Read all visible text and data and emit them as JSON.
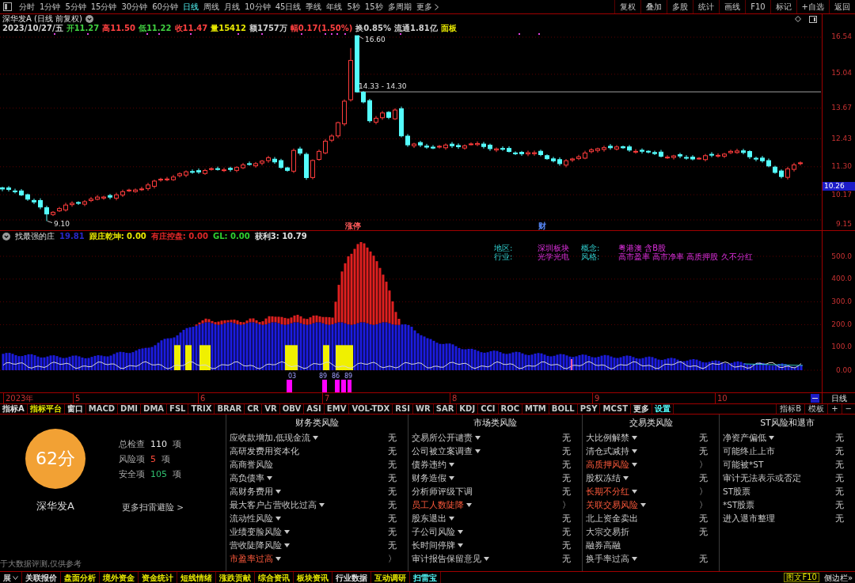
{
  "toolbar": {
    "periods": [
      {
        "label": "分时",
        "selected": false
      },
      {
        "label": "1分钟",
        "selected": false
      },
      {
        "label": "5分钟",
        "selected": false
      },
      {
        "label": "15分钟",
        "selected": false
      },
      {
        "label": "30分钟",
        "selected": false
      },
      {
        "label": "60分钟",
        "selected": false
      },
      {
        "label": "日线",
        "selected": true
      },
      {
        "label": "周线",
        "selected": false
      },
      {
        "label": "月线",
        "selected": false
      },
      {
        "label": "10分钟",
        "selected": false
      },
      {
        "label": "45日线",
        "selected": false
      },
      {
        "label": "季线",
        "selected": false
      },
      {
        "label": "年线",
        "selected": false
      },
      {
        "label": "5秒",
        "selected": false
      },
      {
        "label": "15秒",
        "selected": false
      },
      {
        "label": "多周期",
        "selected": false
      }
    ],
    "more": "更多",
    "actions": [
      "复权",
      "叠加",
      "多股",
      "统计",
      "画线",
      "F10",
      "标记",
      "+自选",
      "返回"
    ]
  },
  "chart_header": {
    "title": "深华发A (日线 前复权)",
    "quote": [
      {
        "text": "2023/10/27/五",
        "color": "#d0d0d0"
      },
      {
        "text": "开11.27",
        "color": "#40d040"
      },
      {
        "text": "高11.50",
        "color": "#ff4040"
      },
      {
        "text": "低11.22",
        "color": "#40d040"
      },
      {
        "text": "收11.47",
        "color": "#ff4040"
      },
      {
        "text": "量15412",
        "color": "#e8e800"
      },
      {
        "text": "额1757万",
        "color": "#d0d0d0"
      },
      {
        "text": "幅0.17(1.50%)",
        "color": "#ff4040"
      },
      {
        "text": "换0.85%",
        "color": "#d0d0d0"
      },
      {
        "text": "流通1.81亿",
        "color": "#d0d0d0"
      },
      {
        "text": "面板",
        "color": "#e8e800"
      }
    ]
  },
  "price_chart": {
    "axis": [
      "16.54",
      "15.04",
      "13.67",
      "12.43",
      "11.30",
      "10.17",
      "9.15"
    ],
    "current_price": "10.26",
    "high_label": "16.60",
    "level_label": "14.33 - 14.30",
    "low_label": "9.10",
    "event_tags": [
      {
        "text": "涨停",
        "color": "#ff5a5a"
      },
      {
        "text": "财",
        "color": "#5a8cff"
      }
    ]
  },
  "indicator": {
    "name": "找最强的庄",
    "value": "19.81",
    "lines": [
      {
        "text": "跟庄乾坤: 0.00",
        "color": "#e8e800"
      },
      {
        "text": "有庄控盘: 0.00",
        "color": "#e02828"
      },
      {
        "text": "GL: 0.00",
        "color": "#30d030"
      },
      {
        "text": "获利3: 10.79",
        "color": "#e0e0e0"
      }
    ],
    "tags": [
      {
        "label": "地区:",
        "value": "深圳板块"
      },
      {
        "label": "概念:",
        "value": "粤港澳 含B股"
      },
      {
        "label": "行业:",
        "value": "光学光电"
      },
      {
        "label": "风格:",
        "value": "高市盈率 高市净率 高质押股 久不分红"
      }
    ],
    "signal_labels": [
      "03",
      "89",
      "86",
      "89"
    ],
    "axis": [
      "500.0",
      "400.0",
      "300.0",
      "200.0",
      "100.0",
      "0.00"
    ]
  },
  "date_axis": {
    "labels": [
      "2023年",
      "5",
      "6",
      "7",
      "8",
      "9",
      "10"
    ],
    "period": "日线"
  },
  "indicator_tabs": {
    "tabs": [
      {
        "label": "指标A",
        "color": "#e0e0e0"
      },
      {
        "label": "指标平台",
        "color": "#e8e800"
      },
      {
        "label": "窗口",
        "color": "#e0e0e0"
      },
      {
        "label": "MACD",
        "color": "#c8c8c8"
      },
      {
        "label": "DMI",
        "color": "#c8c8c8"
      },
      {
        "label": "DMA",
        "color": "#c8c8c8"
      },
      {
        "label": "FSL",
        "color": "#c8c8c8"
      },
      {
        "label": "TRIX",
        "color": "#c8c8c8"
      },
      {
        "label": "BRAR",
        "color": "#c8c8c8"
      },
      {
        "label": "CR",
        "color": "#c8c8c8"
      },
      {
        "label": "VR",
        "color": "#c8c8c8"
      },
      {
        "label": "OBV",
        "color": "#c8c8c8"
      },
      {
        "label": "ASI",
        "color": "#c8c8c8"
      },
      {
        "label": "EMV",
        "color": "#c8c8c8"
      },
      {
        "label": "VOL-TDX",
        "color": "#c8c8c8"
      },
      {
        "label": "RSI",
        "color": "#c8c8c8"
      },
      {
        "label": "WR",
        "color": "#c8c8c8"
      },
      {
        "label": "SAR",
        "color": "#c8c8c8"
      },
      {
        "label": "KDJ",
        "color": "#c8c8c8"
      },
      {
        "label": "CCI",
        "color": "#c8c8c8"
      },
      {
        "label": "ROC",
        "color": "#c8c8c8"
      },
      {
        "label": "MTM",
        "color": "#c8c8c8"
      },
      {
        "label": "BOLL",
        "color": "#c8c8c8"
      },
      {
        "label": "PSY",
        "color": "#c8c8c8"
      },
      {
        "label": "MCST",
        "color": "#c8c8c8"
      },
      {
        "label": "更多",
        "color": "#e0e0e0"
      },
      {
        "label": "设置",
        "color": "#54fcfc"
      }
    ],
    "tools": [
      "指标B",
      "模板",
      "+",
      "−"
    ]
  },
  "risk_scan": {
    "score": "62分",
    "stock_name": "深华发A",
    "stats": [
      {
        "label": "总检查",
        "count": "110",
        "unit": "项",
        "kind": "total"
      },
      {
        "label": "风险项",
        "count": "5",
        "unit": "项",
        "kind": "risk"
      },
      {
        "label": "安全项",
        "count": "105",
        "unit": "项",
        "kind": "safe"
      }
    ],
    "more_link": "更多扫雷避险 >",
    "disclaimer": "于大数据评测,仅供参考",
    "categories": [
      {
        "title": "财务类风险",
        "items": [
          {
            "label": "应收款增加,低现金流",
            "dropdown": true,
            "risk": false,
            "value": "无"
          },
          {
            "label": "高研发费用资本化",
            "dropdown": false,
            "risk": false,
            "value": "无"
          },
          {
            "label": "高商誉风险",
            "dropdown": false,
            "risk": false,
            "value": "无"
          },
          {
            "label": "高负债率",
            "dropdown": true,
            "risk": false,
            "value": "无"
          },
          {
            "label": "高财务费用",
            "dropdown": true,
            "risk": false,
            "value": "无"
          },
          {
            "label": "最大客户占营收比过高",
            "dropdown": true,
            "risk": false,
            "value": "无"
          },
          {
            "label": "流动性风险",
            "dropdown": true,
            "risk": false,
            "value": "无"
          },
          {
            "label": "业绩变脸风险",
            "dropdown": true,
            "risk": false,
            "value": "无"
          },
          {
            "label": "营收陡降风险",
            "dropdown": true,
            "risk": false,
            "value": "无"
          },
          {
            "label": "市盈率过高",
            "dropdown": true,
            "risk": true,
            "value": "〉"
          }
        ]
      },
      {
        "title": "市场类风险",
        "items": [
          {
            "label": "交易所公开谴责",
            "dropdown": true,
            "risk": false,
            "value": "无"
          },
          {
            "label": "公司被立案调查",
            "dropdown": true,
            "risk": false,
            "value": "无"
          },
          {
            "label": "债券违约",
            "dropdown": true,
            "risk": false,
            "value": "无"
          },
          {
            "label": "财务造假",
            "dropdown": true,
            "risk": false,
            "value": "无"
          },
          {
            "label": "分析师评级下调",
            "dropdown": false,
            "risk": false,
            "value": "无"
          },
          {
            "label": "员工人数陡降",
            "dropdown": true,
            "risk": true,
            "value": "〉"
          },
          {
            "label": "股东退出",
            "dropdown": true,
            "risk": false,
            "value": "无"
          },
          {
            "label": "子公司风险",
            "dropdown": true,
            "risk": false,
            "value": "无"
          },
          {
            "label": "长时间停牌",
            "dropdown": true,
            "risk": false,
            "value": "无"
          },
          {
            "label": "审计报告保留意见",
            "dropdown": true,
            "risk": false,
            "value": "无"
          }
        ]
      },
      {
        "title": "交易类风险",
        "items": [
          {
            "label": "大比例解禁",
            "dropdown": true,
            "risk": false,
            "value": "无"
          },
          {
            "label": "清仓式减持",
            "dropdown": true,
            "risk": false,
            "value": "无"
          },
          {
            "label": "高质押风险",
            "dropdown": true,
            "risk": true,
            "value": "〉"
          },
          {
            "label": "股权冻结",
            "dropdown": true,
            "risk": false,
            "value": "无"
          },
          {
            "label": "长期不分红",
            "dropdown": true,
            "risk": true,
            "value": "〉"
          },
          {
            "label": "关联交易风险",
            "dropdown": true,
            "risk": true,
            "value": "〉"
          },
          {
            "label": "北上资金卖出",
            "dropdown": false,
            "risk": false,
            "value": "无"
          },
          {
            "label": "大宗交易折",
            "dropdown": false,
            "risk": false,
            "value": "无"
          },
          {
            "label": "融券高融",
            "dropdown": false,
            "risk": false
          },
          {
            "label": "换手率过高",
            "dropdown": true,
            "risk": false,
            "value": "无"
          }
        ]
      },
      {
        "title": "ST风险和退市",
        "items": [
          {
            "label": "净资产偏低",
            "dropdown": true,
            "risk": false,
            "value": "无"
          },
          {
            "label": "可能终止上市",
            "dropdown": false,
            "risk": false,
            "value": "无"
          },
          {
            "label": "可能被*ST",
            "dropdown": false,
            "risk": false,
            "value": "无"
          },
          {
            "label": "审计无法表示或否定",
            "dropdown": false,
            "risk": false,
            "value": "无"
          },
          {
            "label": "ST股票",
            "dropdown": false,
            "risk": false,
            "value": "无"
          },
          {
            "label": "*ST股票",
            "dropdown": false,
            "risk": false,
            "value": "无"
          },
          {
            "label": "进入退市整理",
            "dropdown": false,
            "risk": false,
            "value": "无"
          }
        ]
      }
    ]
  },
  "status_bar": {
    "expand": "展",
    "tabs": [
      {
        "label": "关联报价",
        "color": "#e0e0e0"
      },
      {
        "label": "盘面分析",
        "color": "#e8e800"
      },
      {
        "label": "境外资金",
        "color": "#e8e800"
      },
      {
        "label": "资金统计",
        "color": "#e8e800"
      },
      {
        "label": "短线情绪",
        "color": "#e8e800"
      },
      {
        "label": "涨跌贡献",
        "color": "#e8e800"
      },
      {
        "label": "综合资讯",
        "color": "#e8e800"
      },
      {
        "label": "板块资讯",
        "color": "#e8e800"
      },
      {
        "label": "行业数据",
        "color": "#e0e0e0"
      },
      {
        "label": "互动调研",
        "color": "#e8e800"
      },
      {
        "label": "扫雷宝",
        "color": "#54fcfc"
      }
    ],
    "f10": "图文F10",
    "sidebar": "侧边栏»"
  }
}
